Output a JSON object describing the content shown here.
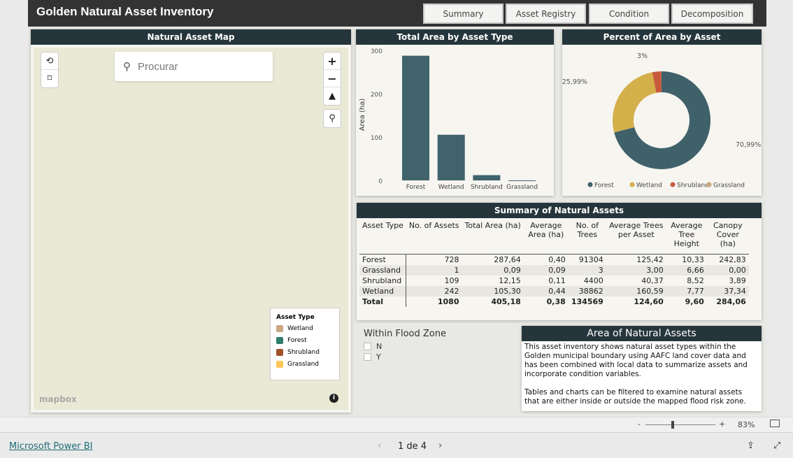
{
  "header": {
    "title": "Golden Natural Asset Inventory",
    "nav": [
      "Summary",
      "Asset Registry",
      "Condition",
      "Decomposition"
    ]
  },
  "map": {
    "title": "Natural Asset Map",
    "search_placeholder": "Procurar",
    "zoom_in": "+",
    "zoom_out": "−",
    "attribution": "mapbox",
    "info": "i",
    "legend": {
      "title": "Asset Type",
      "items": [
        {
          "label": "Wetland",
          "color": "#c9a882"
        },
        {
          "label": "Forest",
          "color": "#2e7d6b"
        },
        {
          "label": "Shrubland",
          "color": "#a0522d"
        },
        {
          "label": "Grassland",
          "color": "#ffc658"
        }
      ]
    }
  },
  "chart_data": [
    {
      "type": "bar",
      "title": "Total Area by Asset Type",
      "ylabel": "Area (ha)",
      "xlabel": "",
      "categories": [
        "Forest",
        "Wetland",
        "Shrubland",
        "Grassland"
      ],
      "values": [
        287.64,
        105.3,
        12.15,
        0.09
      ],
      "ylim": [
        0,
        300
      ],
      "yticks": [
        "0",
        "100",
        "200",
        "300"
      ],
      "color": "#40636c"
    },
    {
      "type": "pie",
      "title": "Percent of Area by Asset",
      "donut": true,
      "categories": [
        "Forest",
        "Wetland",
        "Shrubland",
        "Grassland"
      ],
      "values": [
        70.99,
        25.99,
        3.0,
        0.02
      ],
      "labels": [
        "70,99%",
        "25,99%",
        "3%",
        ""
      ],
      "colors": [
        "#3f616a",
        "#d4b04a",
        "#c85a3c",
        "#c9a97a"
      ],
      "legend": "bottom"
    }
  ],
  "table": {
    "title": "Summary of Natural Assets",
    "columns": [
      "Asset Type",
      "No. of Assets",
      "Total Area (ha)",
      "Average Area (ha)",
      "No. of Trees",
      "Average Trees per Asset",
      "Average Tree Height",
      "Canopy Cover (ha)"
    ],
    "rows": [
      [
        "Forest",
        "728",
        "287,64",
        "0,40",
        "91304",
        "125,42",
        "10,33",
        "242,83"
      ],
      [
        "Grassland",
        "1",
        "0,09",
        "0,09",
        "3",
        "3,00",
        "6,66",
        "0,00"
      ],
      [
        "Shrubland",
        "109",
        "12,15",
        "0,11",
        "4400",
        "40,37",
        "8,52",
        "3,89"
      ],
      [
        "Wetland",
        "242",
        "105,30",
        "0,44",
        "38862",
        "160,59",
        "7,77",
        "37,34"
      ]
    ],
    "total": [
      "Total",
      "1080",
      "405,18",
      "0,38",
      "134569",
      "124,60",
      "9,60",
      "284,06"
    ]
  },
  "flood": {
    "title": "Within Flood Zone",
    "options": [
      "N",
      "Y"
    ]
  },
  "info": {
    "title": "Area of Natural Assets",
    "p1": "This asset inventory shows natural asset types within the Golden municipal boundary using AAFC land cover data and has been combined with local data to summarize assets and incorporate condition variables.",
    "p2": "Tables and charts can be filtered to examine natural assets that are either inside or outside the mapped flood risk zone."
  },
  "zoombar": {
    "minus": "-",
    "plus": "+",
    "zoom": "83%",
    "level": 83
  },
  "footer": {
    "brand": "Microsoft Power BI",
    "page": "1 de 4"
  }
}
